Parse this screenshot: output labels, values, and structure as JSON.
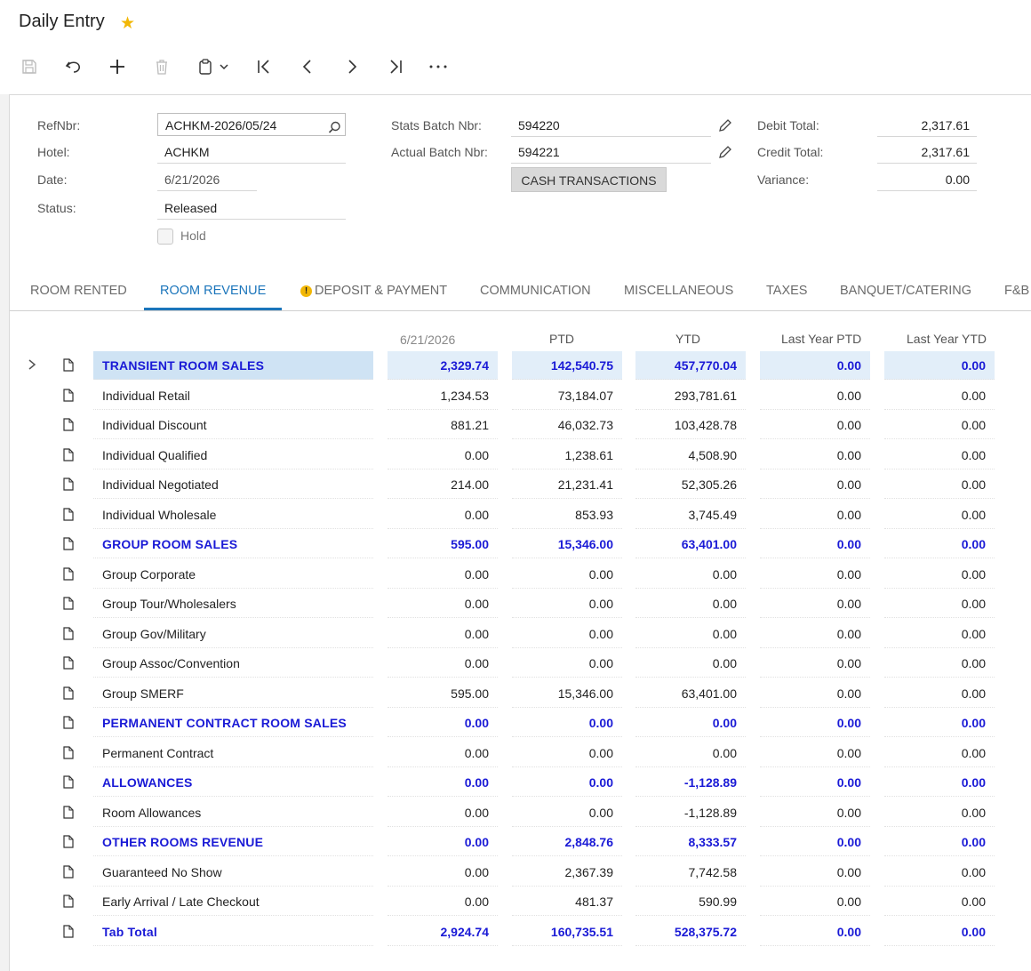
{
  "header": {
    "title": "Daily Entry",
    "star_icon": "star-icon"
  },
  "toolbar": {
    "icons": [
      "save-icon",
      "undo-icon",
      "add-icon",
      "delete-icon",
      "clipboard-icon",
      "first-icon",
      "previous-icon",
      "next-icon",
      "last-icon",
      "more-icon"
    ]
  },
  "form": {
    "refnbr_label": "RefNbr:",
    "refnbr_value": "ACHKM-2026/05/24",
    "hotel_label": "Hotel:",
    "hotel_value": "ACHKM",
    "date_label": "Date:",
    "date_value": "6/21/2026",
    "status_label": "Status:",
    "status_value": "Released",
    "hold_label": "Hold",
    "stats_batch_label": "Stats Batch Nbr:",
    "stats_batch_value": "594220",
    "actual_batch_label": "Actual Batch Nbr:",
    "actual_batch_value": "594221",
    "cash_button": "CASH TRANSACTIONS",
    "debit_label": "Debit Total:",
    "debit_value": "2,317.61",
    "credit_label": "Credit Total:",
    "credit_value": "2,317.61",
    "variance_label": "Variance:",
    "variance_value": "0.00"
  },
  "tabs": [
    {
      "label": "ROOM RENTED"
    },
    {
      "label": "ROOM REVENUE"
    },
    {
      "label": "DEPOSIT & PAYMENT"
    },
    {
      "label": "COMMUNICATION"
    },
    {
      "label": "MISCELLANEOUS"
    },
    {
      "label": "TAXES"
    },
    {
      "label": "BANQUET/CATERING"
    },
    {
      "label": "F&B"
    }
  ],
  "grid": {
    "columns": [
      "6/21/2026",
      "PTD",
      "YTD",
      "Last Year PTD",
      "Last Year YTD"
    ],
    "rows": [
      {
        "desc": "TRANSIENT ROOM SALES",
        "hdr": true,
        "v": [
          "2,329.74",
          "142,540.75",
          "457,770.04",
          "0.00",
          "0.00"
        ]
      },
      {
        "desc": "Individual Retail",
        "v": [
          "1,234.53",
          "73,184.07",
          "293,781.61",
          "0.00",
          "0.00"
        ]
      },
      {
        "desc": "Individual Discount",
        "v": [
          "881.21",
          "46,032.73",
          "103,428.78",
          "0.00",
          "0.00"
        ]
      },
      {
        "desc": "Individual Qualified",
        "v": [
          "0.00",
          "1,238.61",
          "4,508.90",
          "0.00",
          "0.00"
        ]
      },
      {
        "desc": "Individual Negotiated",
        "v": [
          "214.00",
          "21,231.41",
          "52,305.26",
          "0.00",
          "0.00"
        ]
      },
      {
        "desc": "Individual Wholesale",
        "v": [
          "0.00",
          "853.93",
          "3,745.49",
          "0.00",
          "0.00"
        ]
      },
      {
        "desc": "GROUP ROOM SALES",
        "hdr": true,
        "v": [
          "595.00",
          "15,346.00",
          "63,401.00",
          "0.00",
          "0.00"
        ]
      },
      {
        "desc": "Group Corporate",
        "v": [
          "0.00",
          "0.00",
          "0.00",
          "0.00",
          "0.00"
        ]
      },
      {
        "desc": "Group Tour/Wholesalers",
        "v": [
          "0.00",
          "0.00",
          "0.00",
          "0.00",
          "0.00"
        ]
      },
      {
        "desc": "Group Gov/Military",
        "v": [
          "0.00",
          "0.00",
          "0.00",
          "0.00",
          "0.00"
        ]
      },
      {
        "desc": "Group Assoc/Convention",
        "v": [
          "0.00",
          "0.00",
          "0.00",
          "0.00",
          "0.00"
        ]
      },
      {
        "desc": "Group SMERF",
        "v": [
          "595.00",
          "15,346.00",
          "63,401.00",
          "0.00",
          "0.00"
        ]
      },
      {
        "desc": "PERMANENT CONTRACT ROOM SALES",
        "hdr": true,
        "v": [
          "0.00",
          "0.00",
          "0.00",
          "0.00",
          "0.00"
        ]
      },
      {
        "desc": "Permanent Contract",
        "v": [
          "0.00",
          "0.00",
          "0.00",
          "0.00",
          "0.00"
        ]
      },
      {
        "desc": "ALLOWANCES",
        "hdr": true,
        "v": [
          "0.00",
          "0.00",
          "-1,128.89",
          "0.00",
          "0.00"
        ]
      },
      {
        "desc": "Room Allowances",
        "v": [
          "0.00",
          "0.00",
          "-1,128.89",
          "0.00",
          "0.00"
        ]
      },
      {
        "desc": "OTHER ROOMS REVENUE",
        "hdr": true,
        "v": [
          "0.00",
          "2,848.76",
          "8,333.57",
          "0.00",
          "0.00"
        ]
      },
      {
        "desc": "Guaranteed No Show",
        "v": [
          "0.00",
          "2,367.39",
          "7,742.58",
          "0.00",
          "0.00"
        ]
      },
      {
        "desc": "Early Arrival / Late Checkout",
        "v": [
          "0.00",
          "481.37",
          "590.99",
          "0.00",
          "0.00"
        ]
      },
      {
        "desc": "Tab Total",
        "hdr": true,
        "v": [
          "2,924.74",
          "160,735.51",
          "528,375.72",
          "0.00",
          "0.00"
        ]
      }
    ]
  }
}
